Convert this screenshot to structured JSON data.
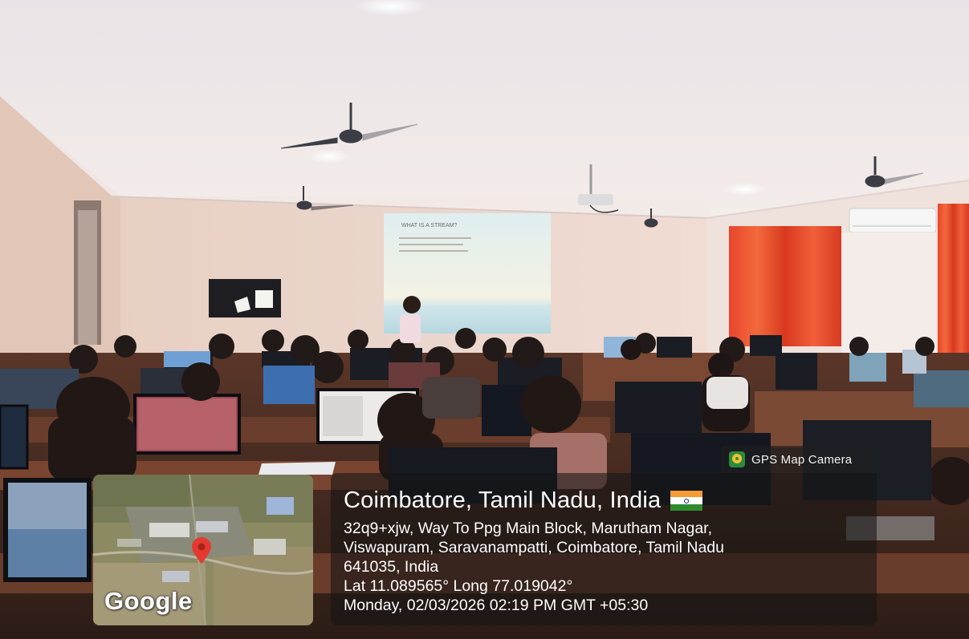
{
  "photo": {
    "projector_slide": {
      "title": "WHAT IS A STREAM?"
    }
  },
  "gps_overlay": {
    "badge_label": "GPS Map Camera",
    "badge_icon": "gps-map-camera-logo-icon",
    "location_title": "Coimbatore, Tamil Nadu, India",
    "flag_icon": "india-flag-icon",
    "address_lines": [
      "32q9+xjw, Way To Ppg Main Block, Marutham Nagar,",
      "Viswapuram, Saravanampatti, Coimbatore, Tamil Nadu",
      "641035, India"
    ],
    "coordinates": "Lat 11.089565° Long 77.019042°",
    "datetime": "Monday, 02/03/2026 02:19 PM GMT +05:30",
    "map": {
      "brand": "Google",
      "pin_icon": "map-pin-icon"
    }
  }
}
